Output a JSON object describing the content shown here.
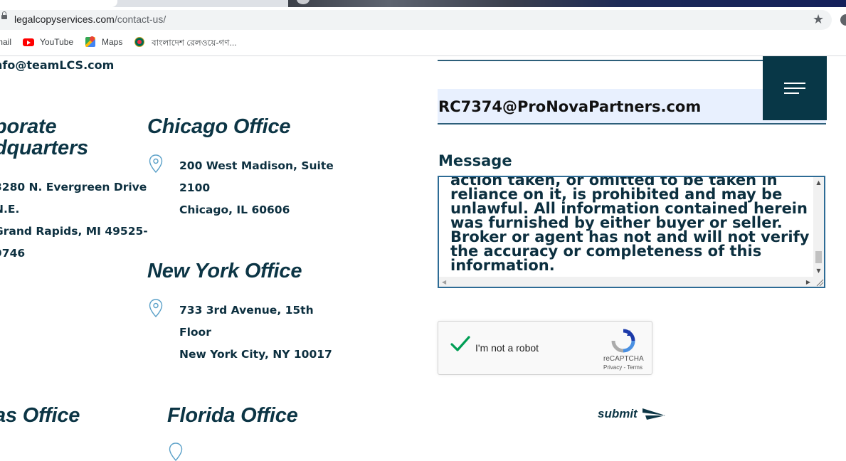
{
  "browser": {
    "url_domain": "legalcopyservices.com",
    "url_path": "/contact-us/",
    "star_icon": "★",
    "bookmarks": [
      {
        "label": "mail",
        "icon": "gmail-icon"
      },
      {
        "label": "YouTube",
        "icon": "youtube-icon"
      },
      {
        "label": "Maps",
        "icon": "maps-icon"
      },
      {
        "label": "বাংলাদেশ রেলওয়ে-গণ...",
        "icon": "bangladesh-railway-icon"
      }
    ]
  },
  "contact": {
    "email": "nfo@teamLCS.com"
  },
  "offices": [
    {
      "title": "porate",
      "title2": "dquarters",
      "lines": [
        "3280 N. Evergreen Drive",
        "N.E.",
        "Grand Rapids, MI 49525-",
        "9746"
      ]
    },
    {
      "title": "Chicago Office",
      "lines": [
        "200 West Madison, Suite",
        "2100",
        "Chicago, IL 60606"
      ]
    },
    {
      "title": "New York Office",
      "lines": [
        "733 3rd Avenue, 15th",
        "Floor",
        "New York City, NY 10017"
      ]
    },
    {
      "title": "as Office"
    },
    {
      "title": "Florida Office"
    }
  ],
  "form": {
    "email_value": "RC7374@ProNovaPartners.com",
    "message_label": "Message",
    "message_lines": [
      "action taken, or omitted to be taken in",
      "reliance on it, is prohibited and may be",
      "unlawful.  All information contained herein",
      "was furnished by either buyer or seller.",
      "Broker or agent has not and will not verify",
      "the accuracy or completeness of this",
      "information."
    ],
    "captcha_label": "I'm not a robot",
    "captcha_brand": "reCAPTCHA",
    "captcha_links": "Privacy - Terms",
    "captcha_checked": true,
    "submit_label": "submit"
  },
  "colors": {
    "brand_dark": "#083747",
    "text_dark": "#0c2f3f",
    "field_border": "#2d5f7a",
    "field_fill": "#e8f0fe",
    "check_green": "#009e55"
  }
}
